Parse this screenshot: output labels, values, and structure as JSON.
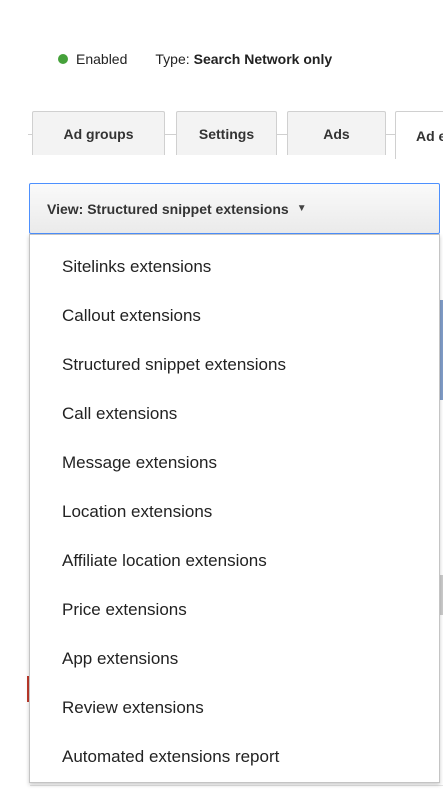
{
  "status": {
    "state_label": "Enabled",
    "state_color": "#45a13a",
    "type_label": "Type:",
    "type_value": "Search Network only"
  },
  "tabs": [
    {
      "label": "Ad groups"
    },
    {
      "label": "Settings"
    },
    {
      "label": "Ads"
    },
    {
      "label": "Ad extensions"
    }
  ],
  "view_button": {
    "label": "View: Structured snippet extensions",
    "caret": "▼"
  },
  "menu": {
    "items": [
      {
        "label": "Sitelinks extensions"
      },
      {
        "label": "Callout extensions"
      },
      {
        "label": "Structured snippet extensions"
      },
      {
        "label": "Call extensions"
      },
      {
        "label": "Message extensions"
      },
      {
        "label": "Location extensions"
      },
      {
        "label": "Affiliate location extensions"
      },
      {
        "label": "Price extensions"
      },
      {
        "label": "App extensions"
      },
      {
        "label": "Review extensions"
      },
      {
        "label": "Automated extensions report"
      }
    ]
  },
  "colors": {
    "accent_border": "#4d90fe",
    "status_enabled": "#45a13a"
  }
}
